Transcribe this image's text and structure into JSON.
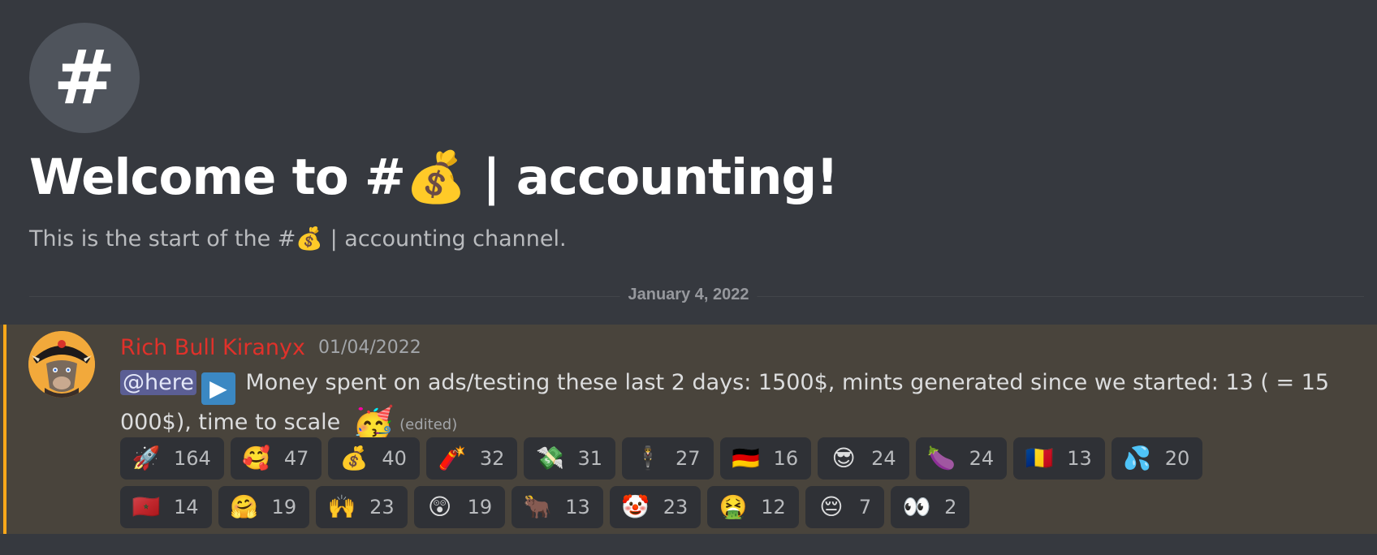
{
  "channel": {
    "icon_glyph": "#",
    "welcome_title": "Welcome to #💰 | accounting!",
    "welcome_subtitle": "This is the start of the #💰 | accounting channel."
  },
  "divider": {
    "date": "January 4, 2022"
  },
  "message": {
    "author": "Rich Bull Kiranyx",
    "timestamp": "01/04/2022",
    "mention": "@here",
    "play_emoji": "▶",
    "text": "Money spent on ads/testing these last 2 days: 1500$, mints generated since we started: 13 ( = 15 000$), time to scale",
    "trailing_emoji": "🥳",
    "edited": "(edited)",
    "author_color": "#e0312a",
    "mention_bar_color": "#faa81a",
    "reactions": [
      {
        "emoji": "🚀",
        "count": "164"
      },
      {
        "emoji": "🥰",
        "count": "47"
      },
      {
        "emoji": "💰",
        "count": "40"
      },
      {
        "emoji": "🧨",
        "count": "32"
      },
      {
        "emoji": "💸",
        "count": "31"
      },
      {
        "emoji": "🕴️",
        "count": "27"
      },
      {
        "emoji": "🇩🇪",
        "count": "16"
      },
      {
        "emoji": "😎",
        "count": "24"
      },
      {
        "emoji": "🍆",
        "count": "24"
      },
      {
        "emoji": "🇷🇴",
        "count": "13"
      },
      {
        "emoji": "💦",
        "count": "20"
      },
      {
        "emoji": "🇲🇦",
        "count": "14"
      },
      {
        "emoji": "🤗",
        "count": "19"
      },
      {
        "emoji": "🙌",
        "count": "23"
      },
      {
        "emoji": "😲",
        "count": "19"
      },
      {
        "emoji": "🐂",
        "count": "13"
      },
      {
        "emoji": "🤡",
        "count": "23"
      },
      {
        "emoji": "🤮",
        "count": "12"
      },
      {
        "emoji": "😔",
        "count": "7"
      },
      {
        "emoji": "👀",
        "count": "2"
      }
    ]
  }
}
